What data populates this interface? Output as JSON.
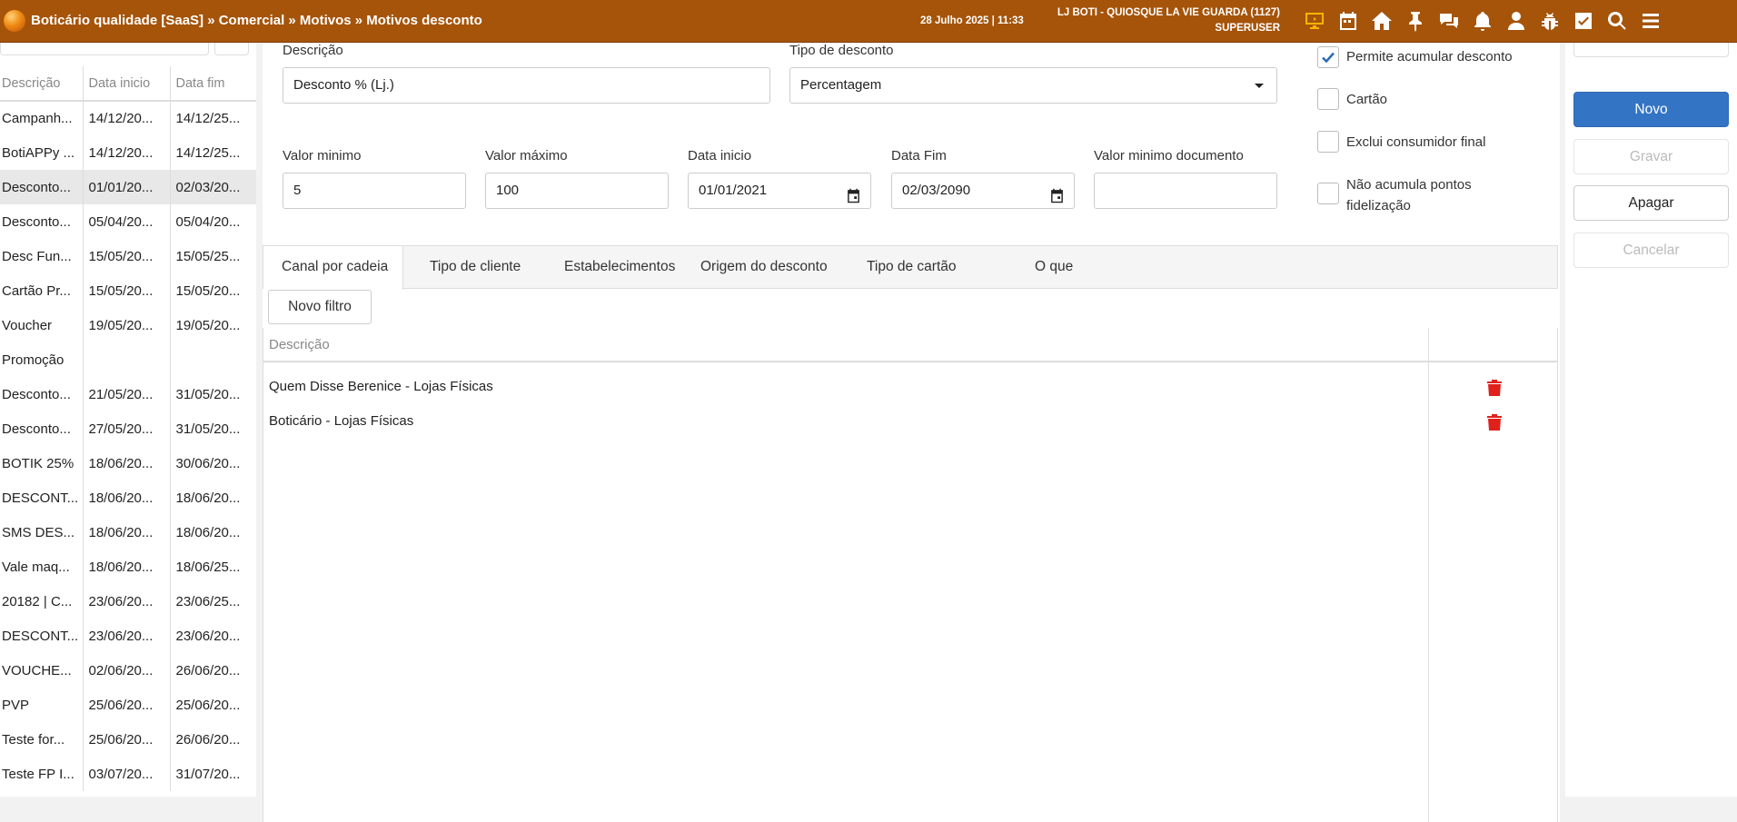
{
  "header": {
    "breadcrumb": "Boticário qualidade [SaaS] » Comercial » Motivos » Motivos desconto",
    "datetime": "28 Julho 2025 | 11:33",
    "store": "LJ BOTI - QUIOSQUE LA VIE GUARDA (1127)",
    "user": "SUPERUSER",
    "icons": [
      "monitor-icon",
      "calendar-icon",
      "home-icon",
      "pin-icon",
      "chat-icon",
      "bell-icon",
      "user-icon",
      "bug-icon",
      "checkbox-icon",
      "search-icon",
      "menu-icon"
    ],
    "accent": "#a5540a"
  },
  "list": {
    "columns": [
      "Descrição",
      "Data inicio",
      "Data fim"
    ],
    "rows": [
      [
        "Campanh...",
        "14/12/20...",
        "14/12/25..."
      ],
      [
        "BotiAPPy ...",
        "14/12/20...",
        "14/12/25..."
      ],
      [
        "Desconto...",
        "01/01/20...",
        "02/03/20..."
      ],
      [
        "Desconto...",
        "05/04/20...",
        "05/04/20..."
      ],
      [
        "Desc Fun...",
        "15/05/20...",
        "15/05/25..."
      ],
      [
        "Cartão Pr...",
        "15/05/20...",
        "15/05/20..."
      ],
      [
        "Voucher",
        "19/05/20...",
        "19/05/20..."
      ],
      [
        "Promoção",
        "",
        ""
      ],
      [
        "Desconto...",
        "21/05/20...",
        "31/05/20..."
      ],
      [
        "Desconto...",
        "27/05/20...",
        "31/05/20..."
      ],
      [
        "BOTIK 25%",
        "18/06/20...",
        "30/06/20..."
      ],
      [
        "DESCONT...",
        "18/06/20...",
        "18/06/20..."
      ],
      [
        "SMS DES...",
        "18/06/20...",
        "18/06/20..."
      ],
      [
        "Vale maq...",
        "18/06/20...",
        "18/06/25..."
      ],
      [
        "20182 | C...",
        "23/06/20...",
        "23/06/25..."
      ],
      [
        "DESCONT...",
        "23/06/20...",
        "23/06/20..."
      ],
      [
        "VOUCHE...",
        "02/06/20...",
        "26/06/20..."
      ],
      [
        "PVP",
        "25/06/20...",
        "25/06/20..."
      ],
      [
        "Teste for...",
        "25/06/20...",
        "26/06/20..."
      ],
      [
        "Teste FP I...",
        "03/07/20...",
        "31/07/20..."
      ]
    ],
    "selected_index": 2
  },
  "form": {
    "descricao_label": "Descrição",
    "descricao_value": "Desconto % (Lj.)",
    "tipo_label": "Tipo de desconto",
    "tipo_value": "Percentagem",
    "valor_min_label": "Valor minimo",
    "valor_min_value": "5",
    "valor_max_label": "Valor máximo",
    "valor_max_value": "100",
    "data_inicio_label": "Data inicio",
    "data_inicio_value": "01/01/2021",
    "data_fim_label": "Data Fim",
    "data_fim_value": "02/03/2090",
    "valor_min_doc_label": "Valor minimo documento",
    "valor_min_doc_value": "",
    "checkboxes": [
      {
        "label": "Permite acumular desconto",
        "checked": true
      },
      {
        "label": "Cartão",
        "checked": false
      },
      {
        "label": "Exclui consumidor final",
        "checked": false
      },
      {
        "label": "Não acumula pontos fidelização",
        "checked": false
      }
    ]
  },
  "tabs": [
    "Canal por cadeia",
    "Tipo de cliente",
    "Estabelecimentos",
    "Origem do desconto",
    "Tipo de cartão",
    "O que"
  ],
  "filters": {
    "new_filter_label": "Novo filtro",
    "column": "Descrição",
    "rows": [
      "Quem Disse Berenice - Lojas Físicas",
      "Boticário - Lojas Físicas"
    ]
  },
  "actions": {
    "novo": "Novo",
    "gravar": "Gravar",
    "apagar": "Apagar",
    "cancelar": "Cancelar",
    "primary_color": "#3474c4"
  }
}
